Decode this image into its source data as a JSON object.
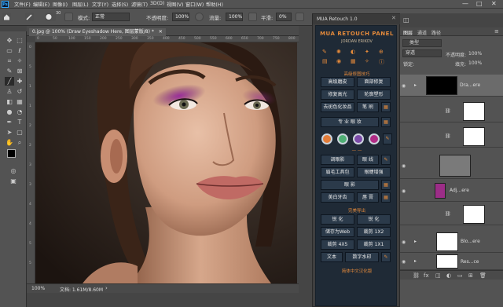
{
  "app": {
    "icon": "Ps"
  },
  "menu": [
    "文件(F)",
    "编辑(E)",
    "图像(I)",
    "图层(L)",
    "文字(Y)",
    "选择(S)",
    "滤镜(T)",
    "3D(D)",
    "视图(V)",
    "窗口(W)",
    "帮助(H)"
  ],
  "window_controls": {
    "minimize": "—",
    "maximize": "□",
    "close": "✕"
  },
  "options_bar": {
    "mode_label": "模式:",
    "mode_value": "正常",
    "opacity_label": "不透明度:",
    "opacity_value": "100%",
    "flow_label": "流量:",
    "flow_value": "100%",
    "smooth_label": "平滑:",
    "smooth_value": "0%",
    "brush_size": "30"
  },
  "document": {
    "tab_title": "0.jpg @ 100% (Draw Eyeshadow Here, 图层蒙版/8) *",
    "tab_close": "✕",
    "ruler_h": [
      "0",
      "50",
      "100",
      "150",
      "200",
      "250",
      "300",
      "350",
      "400",
      "450",
      "500",
      "550",
      "600",
      "650",
      "700",
      "750",
      "800"
    ],
    "ruler_v": [
      "0",
      "5",
      "1",
      "1",
      "2",
      "2",
      "3",
      "3",
      "4",
      "4",
      "5",
      "5"
    ],
    "zoom": "100%",
    "doc_info": "文档: 1.61M/8.60M"
  },
  "mua_panel": {
    "window_title": "MUA Retouch 1.0",
    "close": "✕",
    "header": "MUA RETOUCH PANEL",
    "author": "JORDAN ERIKOV",
    "section1": "高级修图技巧",
    "buttons": [
      {
        "label": "高级磨皮",
        "x": 0
      },
      {
        "label": "面部修复",
        "x": 1
      },
      {
        "label": "修复高光",
        "x": 0
      },
      {
        "label": "轮廓塑形",
        "x": 1
      },
      {
        "label": "去斑色化妆品",
        "x": 0
      },
      {
        "label": "笔 刷",
        "x": 1
      }
    ],
    "main_btn": "专 业 眼 妆",
    "eyeshadow_colors": [
      "#e27c39",
      "#4fae74",
      "#7b4ba8",
      "#b12c86"
    ],
    "buttons2": [
      {
        "label": "调眼影"
      },
      {
        "label": "眼 线"
      },
      {
        "label": "眉毛工具包"
      },
      {
        "label": "眼睫增强"
      },
      {
        "label": "眼 影"
      },
      {
        "label": "美白牙齿"
      },
      {
        "label": "唇 膏"
      }
    ],
    "section2": "完美导出",
    "export": [
      {
        "label": "锐 化"
      },
      {
        "label": "锐 化"
      },
      {
        "label": "储存为Web"
      },
      {
        "label": "裁剪 1X2"
      },
      {
        "label": "裁剪 4X5"
      },
      {
        "label": "裁剪 1X1"
      },
      {
        "label": "文本"
      },
      {
        "label": "数字水印"
      }
    ],
    "footer": "简体中文汉化版"
  },
  "layers_panel": {
    "tabs": [
      "图层",
      "通道",
      "路径"
    ],
    "search_kind": "类型",
    "blend_mode": "穿透",
    "opacity_label": "不透明度:",
    "opacity_value": "100%",
    "lock_label": "锁定:",
    "fill_label": "填充:",
    "fill_value": "100%",
    "layers": [
      {
        "name": "Dra...ere",
        "visible": true
      },
      {
        "name": "",
        "visible": false
      },
      {
        "name": "",
        "visible": false
      },
      {
        "name": "",
        "visible": true
      },
      {
        "name": "Adj...ere",
        "visible": true
      },
      {
        "name": "",
        "visible": false
      },
      {
        "name": "Blo...ere",
        "visible": true
      },
      {
        "name": "Res...ce",
        "visible": true
      }
    ]
  }
}
